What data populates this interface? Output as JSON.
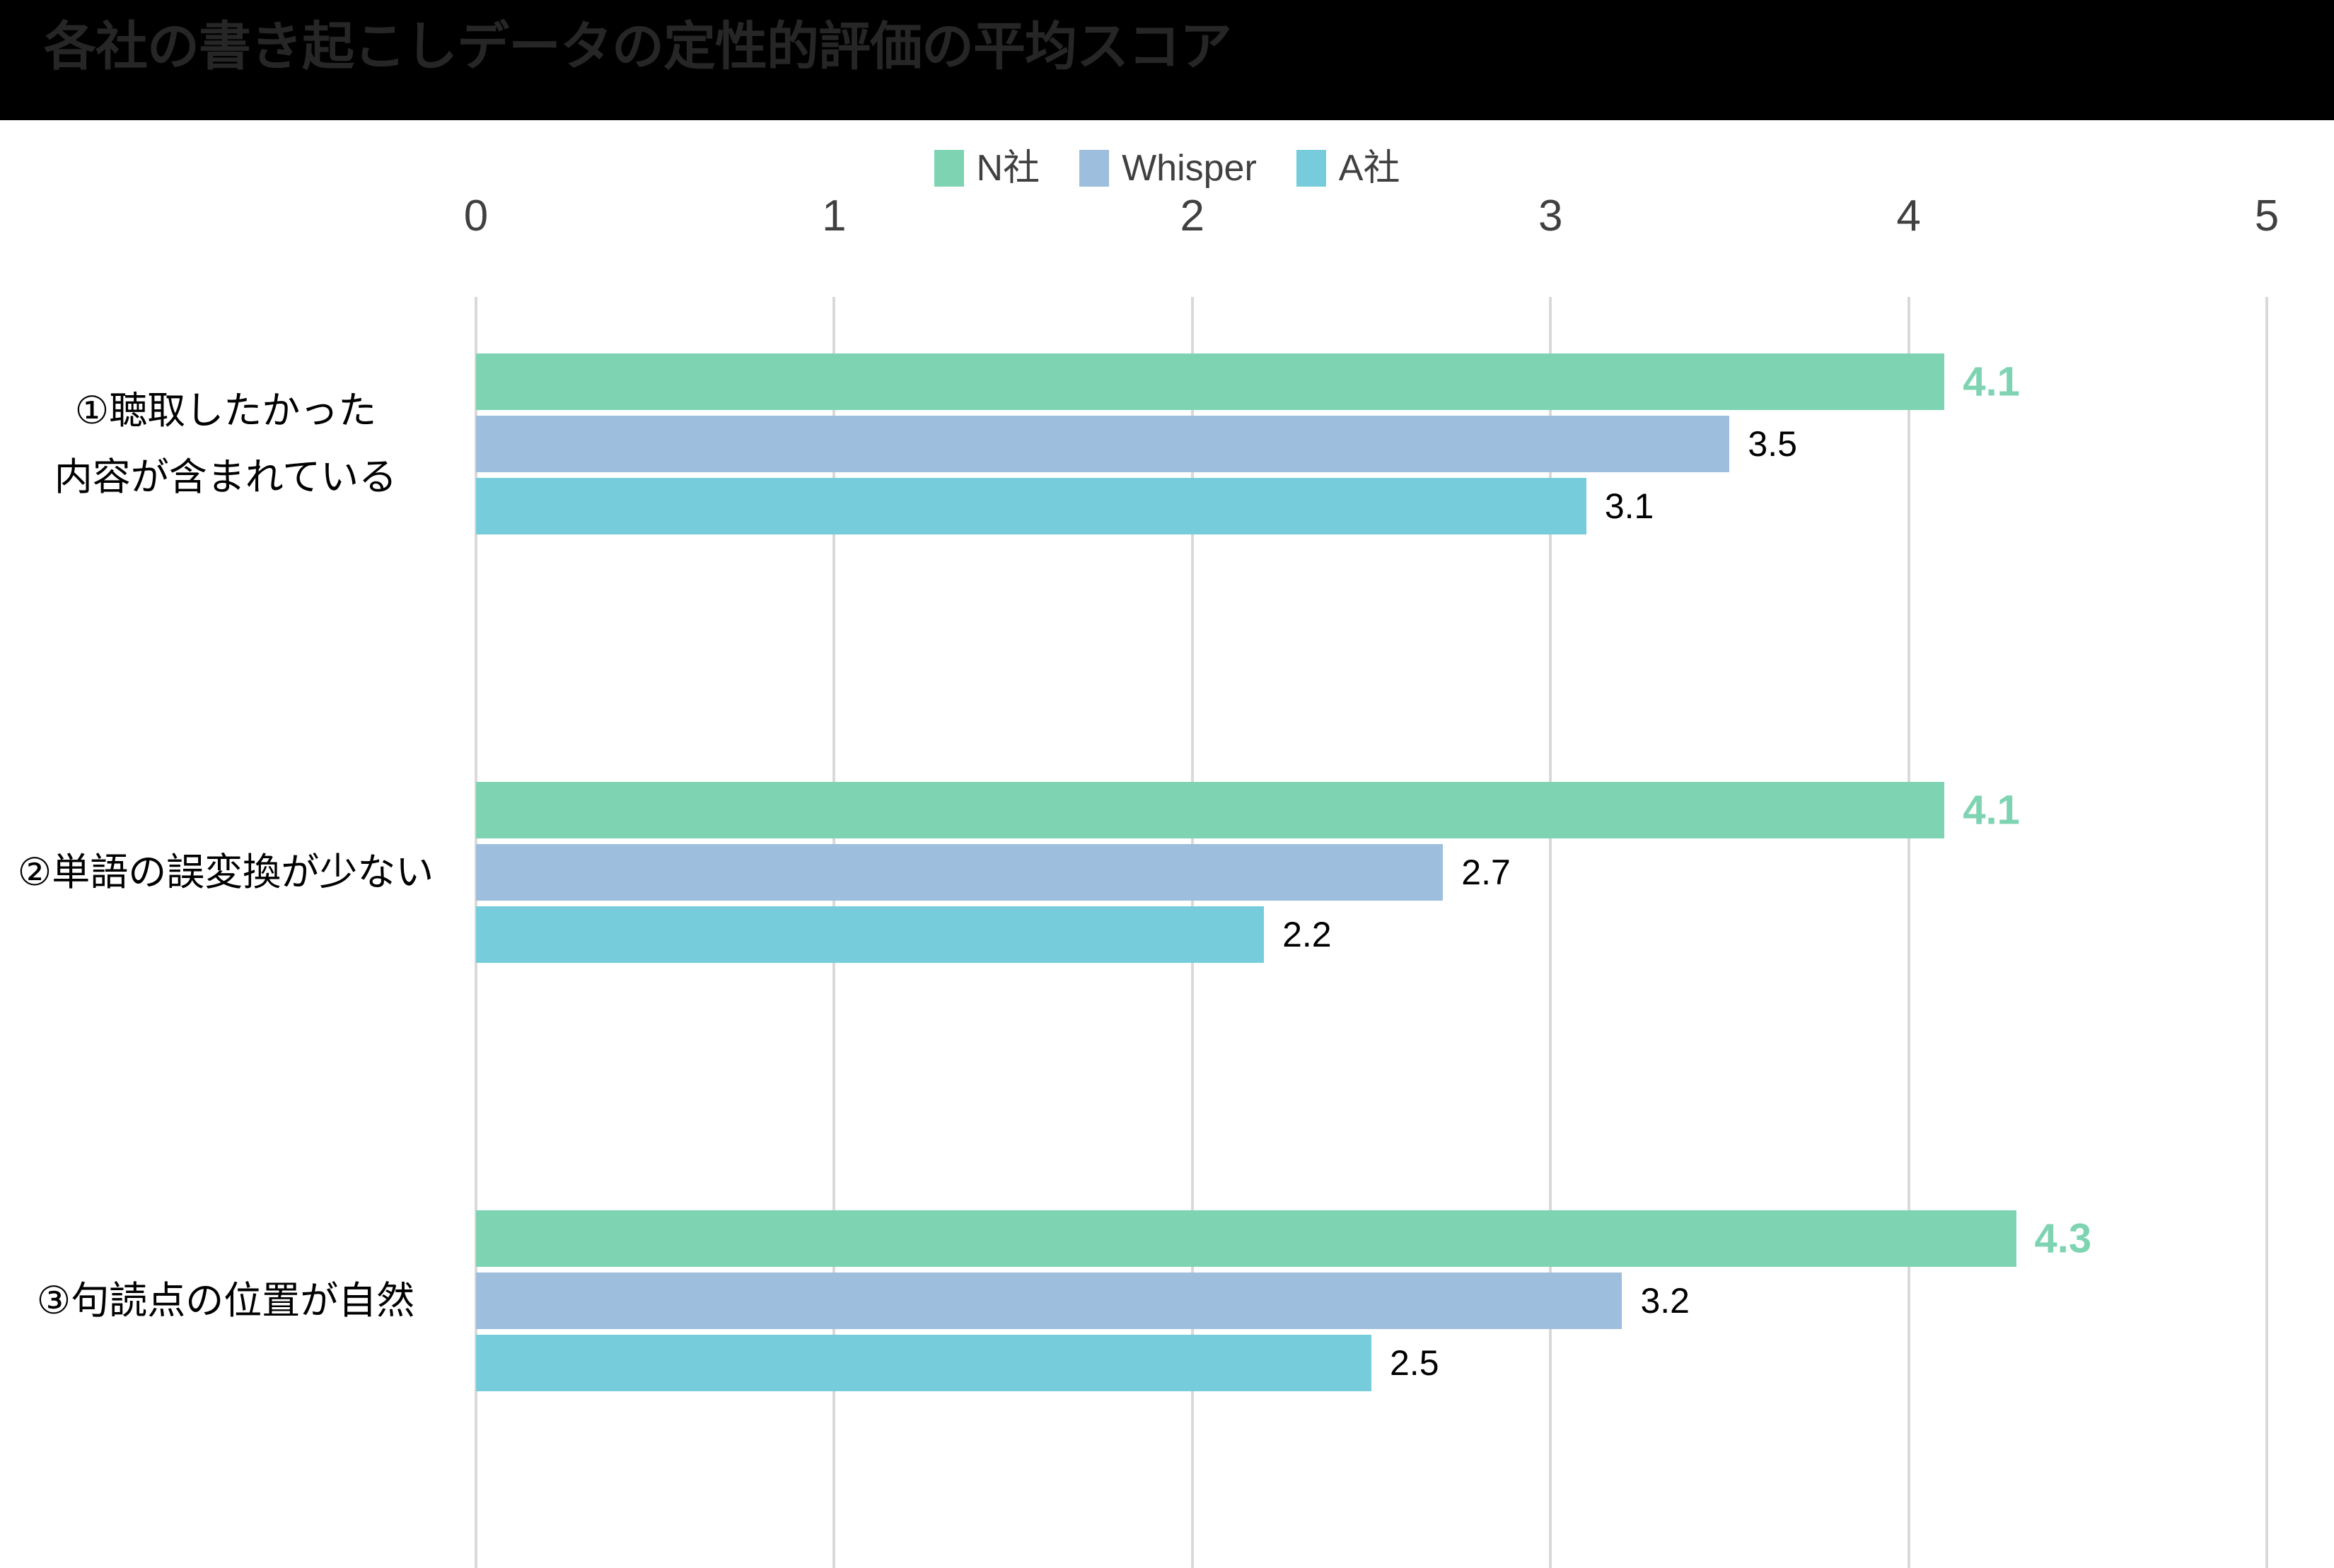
{
  "chart_data": {
    "type": "bar",
    "orientation": "horizontal",
    "title": "各社の書き起こしデータの定性的評価の平均スコア",
    "xlabel": "",
    "ylabel": "",
    "xlim": [
      0,
      5
    ],
    "xticks": [
      "0",
      "1",
      "2",
      "3",
      "4",
      "5"
    ],
    "grid": "vertical",
    "legend_position": "top-center",
    "categories": [
      "①聴取したかった\n内容が含まれている",
      "②単語の誤変換が少ない",
      "③句読点の位置が自然"
    ],
    "series": [
      {
        "name": "N社",
        "color": "#7ed4b2",
        "values": [
          4.1,
          4.1,
          4.3
        ],
        "labels": [
          "4.1",
          "4.1",
          "4.3"
        ],
        "label_style": "bold-colored"
      },
      {
        "name": "Whisper",
        "color": "#9dbedc",
        "values": [
          3.5,
          2.7,
          3.2
        ],
        "labels": [
          "3.5",
          "2.7",
          "3.2"
        ],
        "label_style": "plain"
      },
      {
        "name": "A社",
        "color": "#76ccdb",
        "values": [
          3.1,
          2.2,
          2.5
        ],
        "labels": [
          "3.1",
          "2.2",
          "2.5"
        ],
        "label_style": "plain"
      }
    ]
  },
  "title_bar": {
    "background": "#000000",
    "text_color": "#262626"
  },
  "legend": {
    "items": [
      {
        "label": "N社",
        "color": "#7ed4b2"
      },
      {
        "label": "Whisper",
        "color": "#9dbedc"
      },
      {
        "label": "A社",
        "color": "#76ccdb"
      }
    ]
  },
  "axis": {
    "ticks": [
      "0",
      "1",
      "2",
      "3",
      "4",
      "5"
    ],
    "gridline_color": "#d9d9d9"
  },
  "categories": [
    {
      "lines": [
        "①聴取したかった",
        "内容が含まれている"
      ]
    },
    {
      "lines": [
        "②単語の誤変換が少ない"
      ]
    },
    {
      "lines": [
        "③句読点の位置が自然"
      ]
    }
  ]
}
